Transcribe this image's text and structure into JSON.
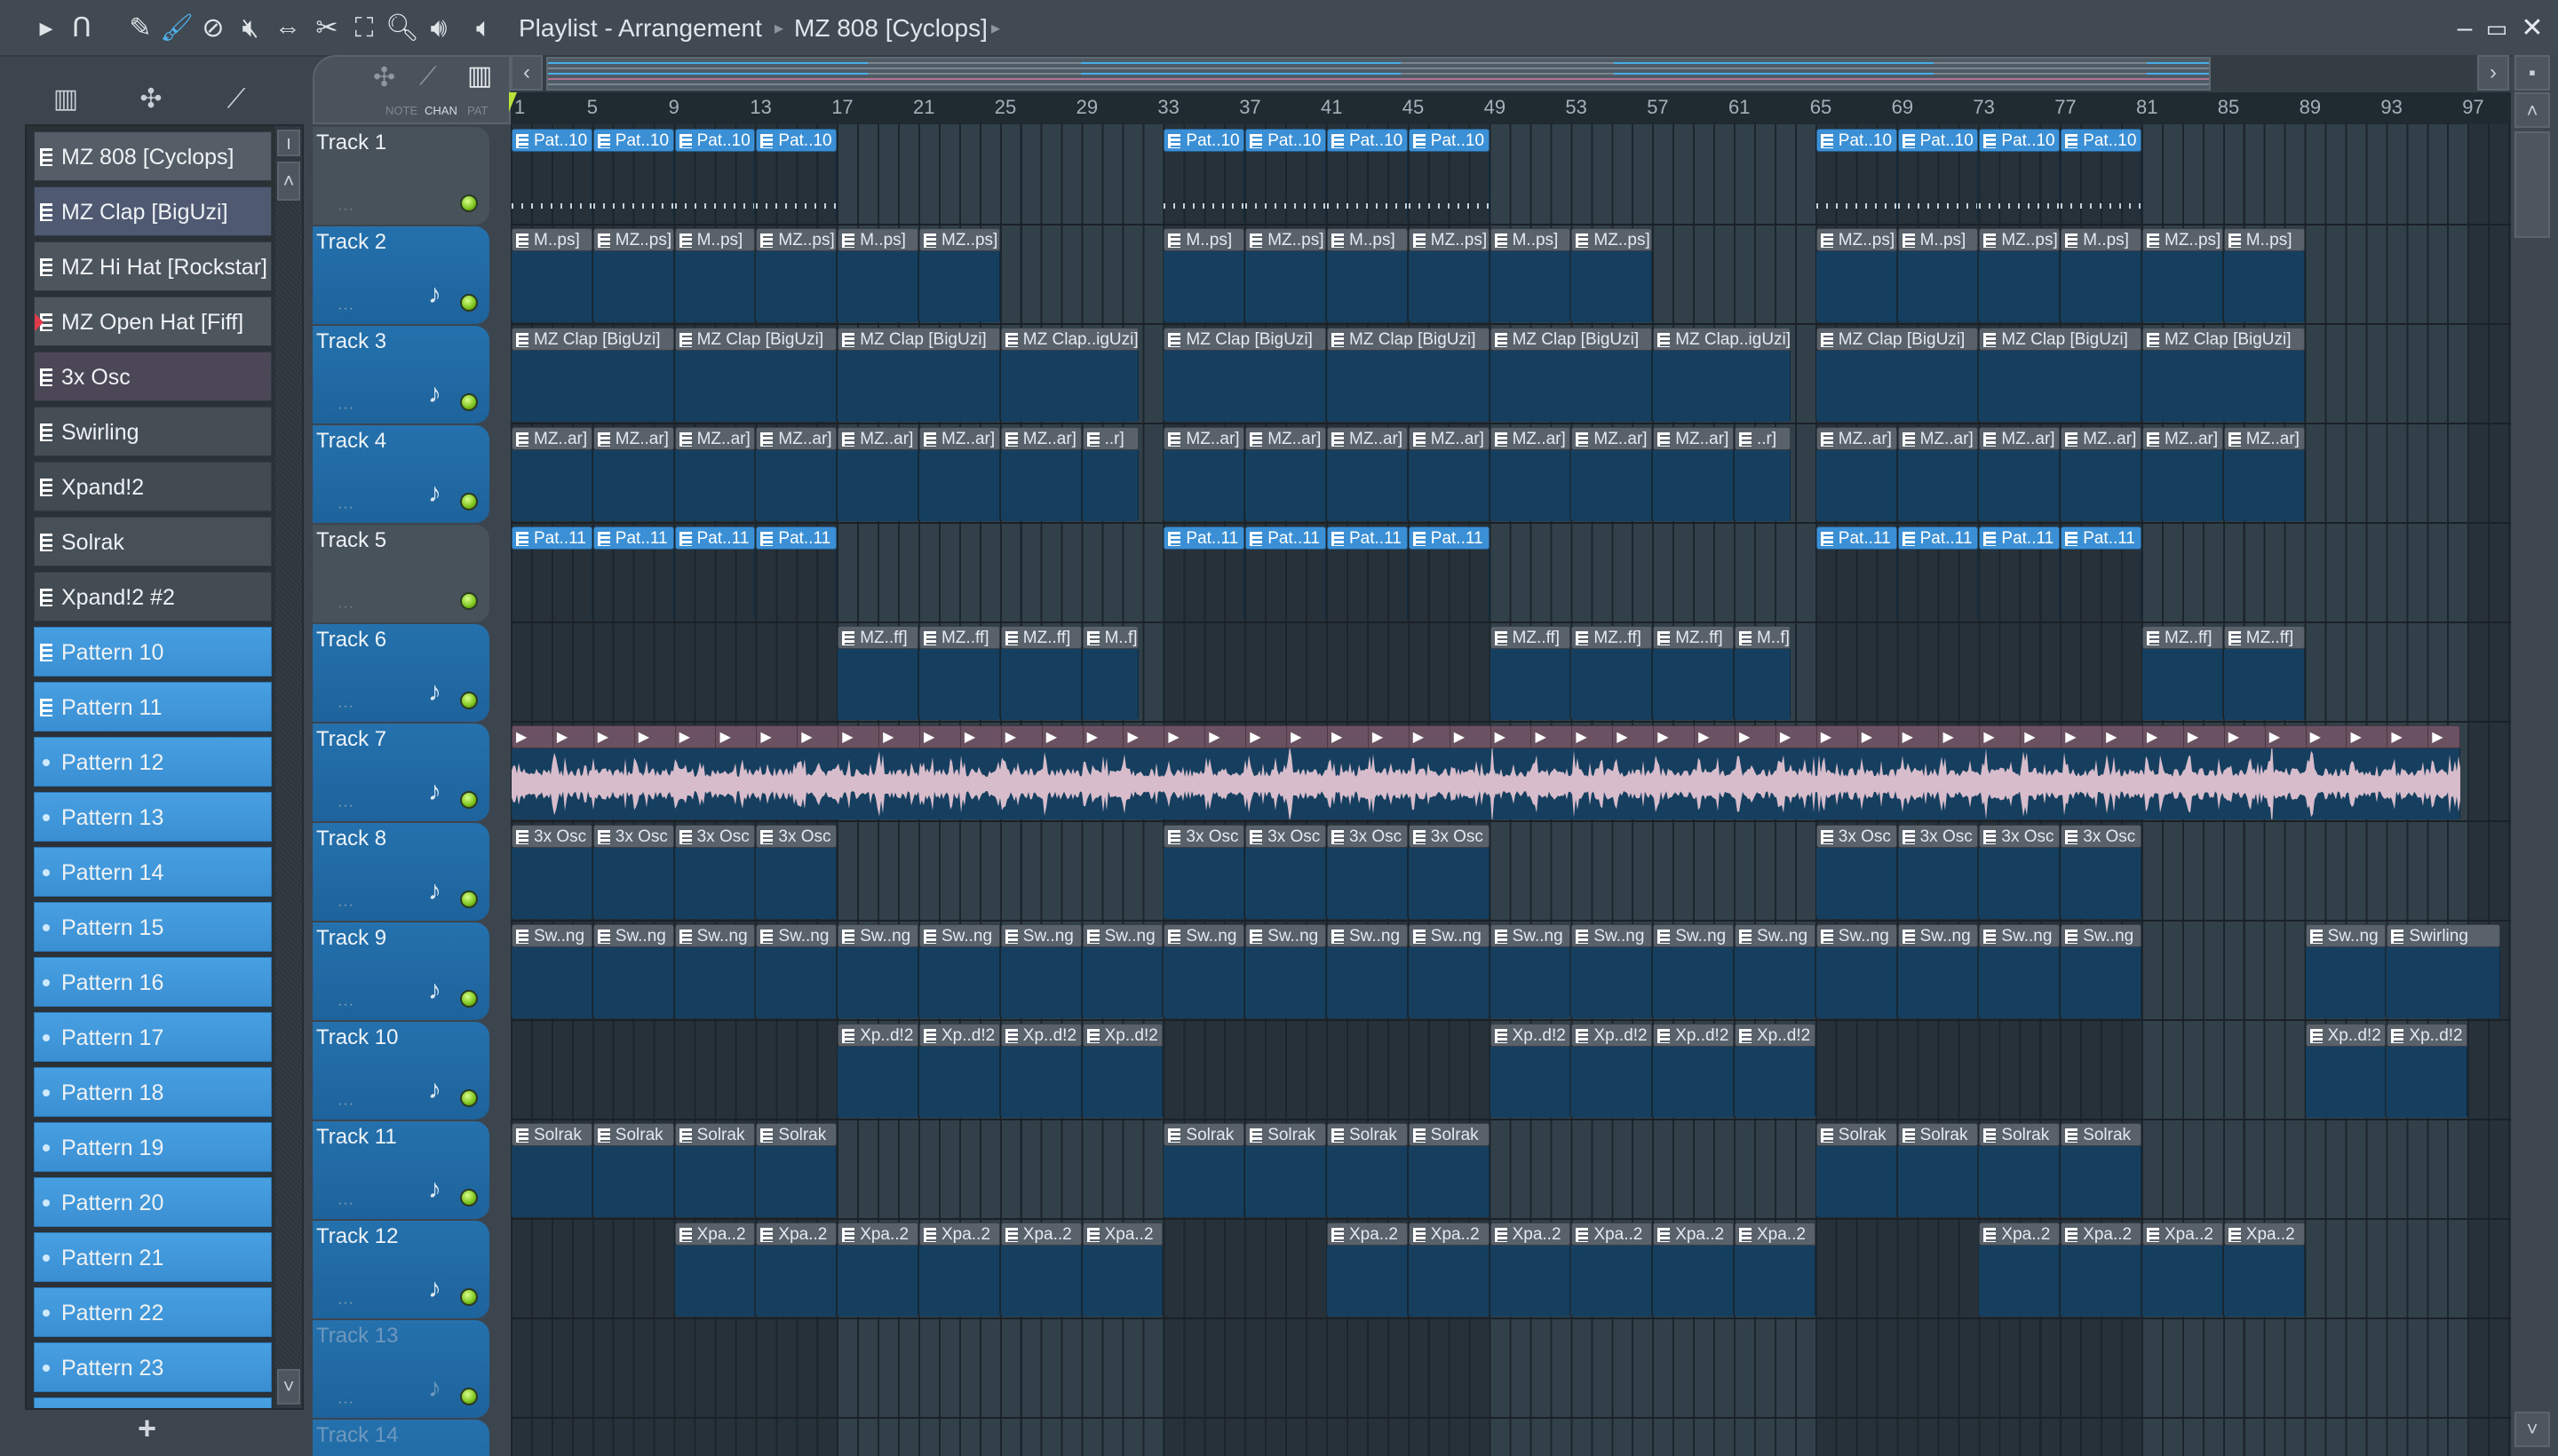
{
  "titlebar": {
    "icons": [
      "play-arrow-icon",
      "magnet-icon",
      "pencil-icon",
      "paint-brush-icon",
      "delete-icon",
      "mute-icon",
      "slip-icon",
      "slice-icon",
      "select-icon",
      "zoom-icon",
      "playback-icon"
    ],
    "title": "Playlist - Arrangement",
    "sub": "MZ 808 [Cyclops]",
    "sep": "▸"
  },
  "browser": {
    "items": [
      {
        "label": "MZ 808 [Cyclops]",
        "kind": "chan",
        "tint": "#555d66"
      },
      {
        "label": "MZ Clap [BigUzi]",
        "kind": "chan",
        "tint": "#4f5a72"
      },
      {
        "label": "MZ Hi Hat [Rockstar]",
        "kind": "chan",
        "tint": "#4d555d"
      },
      {
        "label": "MZ Open Hat [Fiff]",
        "kind": "chan",
        "tint": "#4d555d"
      },
      {
        "label": "3x Osc",
        "kind": "chan",
        "tint": "#4c4756"
      },
      {
        "label": "Swirling",
        "kind": "chan",
        "tint": "#454d55"
      },
      {
        "label": "Xpand!2",
        "kind": "chan",
        "tint": "#434b52"
      },
      {
        "label": "Solrak",
        "kind": "chan",
        "tint": "#474f57"
      },
      {
        "label": "Xpand!2 #2",
        "kind": "chan",
        "tint": "#444c53"
      },
      {
        "label": "Pattern 10",
        "kind": "pat-ico"
      },
      {
        "label": "Pattern 11",
        "kind": "pat-ico"
      },
      {
        "label": "Pattern 12",
        "kind": "pat"
      },
      {
        "label": "Pattern 13",
        "kind": "pat"
      },
      {
        "label": "Pattern 14",
        "kind": "pat"
      },
      {
        "label": "Pattern 15",
        "kind": "pat"
      },
      {
        "label": "Pattern 16",
        "kind": "pat"
      },
      {
        "label": "Pattern 17",
        "kind": "pat"
      },
      {
        "label": "Pattern 18",
        "kind": "pat"
      },
      {
        "label": "Pattern 19",
        "kind": "pat"
      },
      {
        "label": "Pattern 20",
        "kind": "pat"
      },
      {
        "label": "Pattern 21",
        "kind": "pat"
      },
      {
        "label": "Pattern 22",
        "kind": "pat"
      },
      {
        "label": "Pattern 23",
        "kind": "pat"
      },
      {
        "label": "",
        "kind": "pat"
      }
    ],
    "add_label": "+"
  },
  "header": {
    "note": "NOTE",
    "chan": "CHAN",
    "pat": "PAT"
  },
  "ruler": {
    "bars": [
      "1",
      "5",
      "9",
      "13",
      "17",
      "21",
      "25",
      "29",
      "33",
      "37",
      "41",
      "45",
      "49",
      "53",
      "57",
      "61",
      "65",
      "69",
      "73",
      "77",
      "81",
      "85",
      "89",
      "93",
      "97"
    ]
  },
  "tracks": [
    {
      "name": "Track 1",
      "head": "grey",
      "note": false,
      "style": "pat",
      "decor": "d-ticks",
      "groups": [
        {
          "at": 1,
          "len": 4,
          "labels": [
            "Pat..10",
            "Pat..10",
            "Pat..10",
            "Pat..10"
          ]
        },
        {
          "at": 33,
          "len": 4,
          "labels": [
            "Pat..10",
            "Pat..10",
            "Pat..10",
            "Pat..10"
          ]
        },
        {
          "at": 65,
          "len": 4,
          "labels": [
            "Pat..10",
            "Pat..10",
            "Pat..10",
            "Pat..10"
          ]
        }
      ]
    },
    {
      "name": "Track 2",
      "head": "blue",
      "note": true,
      "style": "chan",
      "decor": "d-drum",
      "groups": [
        {
          "at": 1,
          "len": 4,
          "labels": [
            "M..ps]",
            "MZ..ps]",
            "M..ps]",
            "MZ..ps]",
            "M..ps]",
            "MZ..ps]"
          ]
        },
        {
          "at": 33,
          "len": 4,
          "labels": [
            "M..ps]",
            "MZ..ps]",
            "M..ps]",
            "MZ..ps]",
            "M..ps]",
            "MZ..ps]"
          ]
        },
        {
          "at": 65,
          "len": 4,
          "labels": [
            "MZ..ps]",
            "M..ps]",
            "MZ..ps]",
            "M..ps]",
            "MZ..ps]",
            "M..ps]"
          ]
        }
      ]
    },
    {
      "name": "Track 3",
      "head": "blue",
      "note": true,
      "style": "chan",
      "decor": "d-tb",
      "groups": [
        {
          "at": 1,
          "len": 8,
          "last": 6.8,
          "labels": [
            "MZ Clap [BigUzi]",
            "MZ Clap [BigUzi]",
            "MZ Clap [BigUzi]",
            "MZ Clap..igUzi]"
          ]
        },
        {
          "at": 33,
          "len": 8,
          "last": 6.8,
          "labels": [
            "MZ Clap [BigUzi]",
            "MZ Clap [BigUzi]",
            "MZ Clap [BigUzi]",
            "MZ Clap..igUzi]"
          ]
        },
        {
          "at": 65,
          "len": 8,
          "labels": [
            "MZ Clap [BigUzi]",
            "MZ Clap [BigUzi]",
            "MZ Clap [BigUzi]"
          ]
        }
      ]
    },
    {
      "name": "Track 4",
      "head": "blue",
      "note": true,
      "style": "chan",
      "decor": "d-tb",
      "groups": [
        {
          "at": 1,
          "len": 4,
          "last": 2.8,
          "labels": [
            "MZ..ar]",
            "MZ..ar]",
            "MZ..ar]",
            "MZ..ar]",
            "MZ..ar]",
            "MZ..ar]",
            "MZ..ar]",
            "..r]"
          ]
        },
        {
          "at": 33,
          "len": 4,
          "last": 2.8,
          "labels": [
            "MZ..ar]",
            "MZ..ar]",
            "MZ..ar]",
            "MZ..ar]",
            "MZ..ar]",
            "MZ..ar]",
            "MZ..ar]",
            "..r]"
          ]
        },
        {
          "at": 65,
          "len": 4,
          "labels": [
            "MZ..ar]",
            "MZ..ar]",
            "MZ..ar]",
            "MZ..ar]",
            "MZ..ar]",
            "MZ..ar]"
          ]
        }
      ]
    },
    {
      "name": "Track 5",
      "head": "grey",
      "note": false,
      "style": "pat",
      "decor": "",
      "groups": [
        {
          "at": 1,
          "len": 4,
          "labels": [
            "Pat..11",
            "Pat..11",
            "Pat..11",
            "Pat..11"
          ]
        },
        {
          "at": 33,
          "len": 4,
          "labels": [
            "Pat..11",
            "Pat..11",
            "Pat..11",
            "Pat..11"
          ]
        },
        {
          "at": 65,
          "len": 4,
          "labels": [
            "Pat..11",
            "Pat..11",
            "Pat..11",
            "Pat..11"
          ]
        }
      ]
    },
    {
      "name": "Track 6",
      "head": "blue",
      "note": true,
      "style": "chan",
      "decor": "d-tb",
      "groups": [
        {
          "at": 17,
          "len": 4,
          "last": 2.8,
          "labels": [
            "MZ..ff]",
            "MZ..ff]",
            "MZ..ff]",
            "M..f]"
          ]
        },
        {
          "at": 49,
          "len": 4,
          "last": 2.8,
          "labels": [
            "MZ..ff]",
            "MZ..ff]",
            "MZ..ff]",
            "M..f]"
          ]
        },
        {
          "at": 81,
          "len": 4,
          "labels": [
            "MZ..ff]",
            "MZ..ff]"
          ]
        }
      ]
    },
    {
      "name": "Track 7",
      "head": "blue",
      "note": true,
      "style": "audio",
      "decor": "wave",
      "audio": {
        "at": 1,
        "len": 95.6,
        "segment_bars": 2,
        "segment_icon": "▶"
      }
    },
    {
      "name": "Track 8",
      "head": "blue",
      "note": true,
      "style": "chan",
      "decor": "d-sparse",
      "groups": [
        {
          "at": 1,
          "len": 4,
          "labels": [
            "3x Osc",
            "3x Osc",
            "3x Osc",
            "3x Osc"
          ]
        },
        {
          "at": 33,
          "len": 4,
          "labels": [
            "3x Osc",
            "3x Osc",
            "3x Osc",
            "3x Osc"
          ]
        },
        {
          "at": 65,
          "len": 4,
          "labels": [
            "3x Osc",
            "3x Osc",
            "3x Osc",
            "3x Osc"
          ]
        }
      ]
    },
    {
      "name": "Track 9",
      "head": "blue",
      "note": true,
      "style": "chan",
      "decor": "d-lines",
      "groups": [
        {
          "at": 1,
          "len": 4,
          "labels": [
            "Sw..ng",
            "Sw..ng",
            "Sw..ng",
            "Sw..ng",
            "Sw..ng",
            "Sw..ng",
            "Sw..ng",
            "Sw..ng",
            "Sw..ng",
            "Sw..ng",
            "Sw..ng",
            "Sw..ng",
            "Sw..ng",
            "Sw..ng",
            "Sw..ng",
            "Sw..ng",
            "Sw..ng",
            "Sw..ng",
            "Sw..ng",
            "Sw..ng"
          ]
        },
        {
          "at": 89,
          "len": 4,
          "last": 5.6,
          "labels": [
            "Sw..ng",
            "Swirling"
          ]
        }
      ]
    },
    {
      "name": "Track 10",
      "head": "blue",
      "note": true,
      "style": "chan",
      "decor": "d-pink",
      "groups": [
        {
          "at": 17,
          "len": 4,
          "labels": [
            "Xp..d!2",
            "Xp..d!2",
            "Xp..d!2",
            "Xp..d!2"
          ]
        },
        {
          "at": 49,
          "len": 4,
          "labels": [
            "Xp..d!2",
            "Xp..d!2",
            "Xp..d!2",
            "Xp..d!2"
          ]
        },
        {
          "at": 89,
          "len": 4,
          "labels": [
            "Xp..d!2",
            "Xp..d!2"
          ]
        }
      ]
    },
    {
      "name": "Track 11",
      "head": "blue",
      "note": true,
      "style": "chan",
      "decor": "d-sparse",
      "groups": [
        {
          "at": 1,
          "len": 4,
          "labels": [
            "Solrak",
            "Solrak",
            "Solrak",
            "Solrak"
          ]
        },
        {
          "at": 33,
          "len": 4,
          "labels": [
            "Solrak",
            "Solrak",
            "Solrak",
            "Solrak"
          ]
        },
        {
          "at": 65,
          "len": 4,
          "labels": [
            "Solrak",
            "Solrak",
            "Solrak",
            "Solrak"
          ]
        }
      ]
    },
    {
      "name": "Track 12",
      "head": "blue",
      "note": true,
      "style": "chan",
      "decor": "d-dots",
      "groups": [
        {
          "at": 9,
          "len": 4,
          "labels": [
            "Xpa..2",
            "Xpa..2",
            "Xpa..2",
            "Xpa..2",
            "Xpa..2",
            "Xpa..2"
          ]
        },
        {
          "at": 41,
          "len": 4,
          "labels": [
            "Xpa..2",
            "Xpa..2",
            "Xpa..2",
            "Xpa..2",
            "Xpa..2",
            "Xpa..2"
          ]
        },
        {
          "at": 73,
          "len": 4,
          "labels": [
            "Xpa..2",
            "Xpa..2",
            "Xpa..2",
            "Xpa..2"
          ]
        }
      ]
    },
    {
      "name": "Track 13",
      "head": "faded",
      "note": true,
      "groups": []
    },
    {
      "name": "Track 14",
      "head": "faded",
      "note": true,
      "groups": []
    }
  ],
  "colors": {
    "accent": "#3b8fd4",
    "clip_body": "#163f5f",
    "waveform": "#d7bccb",
    "led": "#8fd12a"
  }
}
